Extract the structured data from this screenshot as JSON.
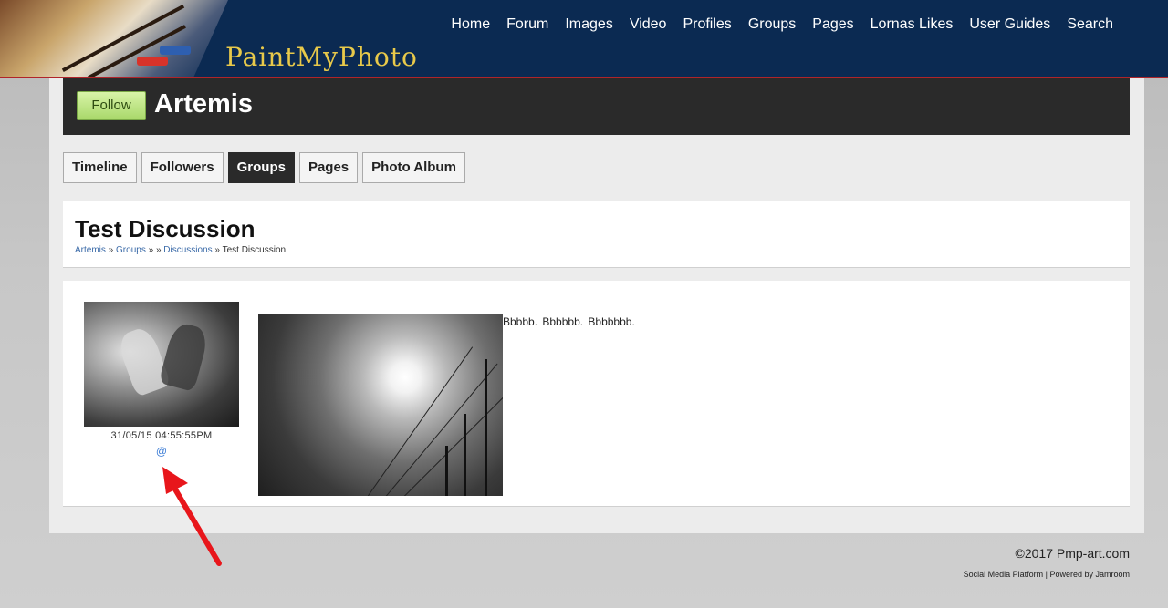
{
  "site": {
    "name": "PaintMyPhoto"
  },
  "nav": [
    {
      "label": "Home"
    },
    {
      "label": "Forum"
    },
    {
      "label": "Images"
    },
    {
      "label": "Video"
    },
    {
      "label": "Profiles"
    },
    {
      "label": "Groups"
    },
    {
      "label": "Pages"
    },
    {
      "label": "Lornas Likes"
    },
    {
      "label": "User Guides"
    },
    {
      "label": "Search"
    }
  ],
  "profile": {
    "follow_label": "Follow",
    "name": "Artemis"
  },
  "tabs": [
    {
      "label": "Timeline",
      "active": false
    },
    {
      "label": "Followers",
      "active": false
    },
    {
      "label": "Groups",
      "active": true
    },
    {
      "label": "Pages",
      "active": false
    },
    {
      "label": "Photo Album",
      "active": false
    }
  ],
  "discussion": {
    "title": "Test Discussion",
    "breadcrumb": {
      "artemis": "Artemis",
      "sep1": " » ",
      "groups": "Groups",
      "sep2": " » » ",
      "discussions": "Discussions",
      "sep3": " » ",
      "current": "Test Discussion"
    }
  },
  "post": {
    "timestamp": "31/05/15 04:55:55PM",
    "at_link": "@",
    "text": "Bbbbb. Bbbbbb.   Bbbbbbb."
  },
  "footer": {
    "copyright": "©2017 Pmp-art.com",
    "platform_text": "Social Media Platform | Powered by Jamroom"
  },
  "colors": {
    "header_bg": "#0b2a52",
    "header_border": "#b0242a",
    "site_name": "#e8c94a",
    "follow_green": "#a9d86a",
    "link_blue": "#3a7bd5",
    "arrow_red": "#e8161b"
  }
}
